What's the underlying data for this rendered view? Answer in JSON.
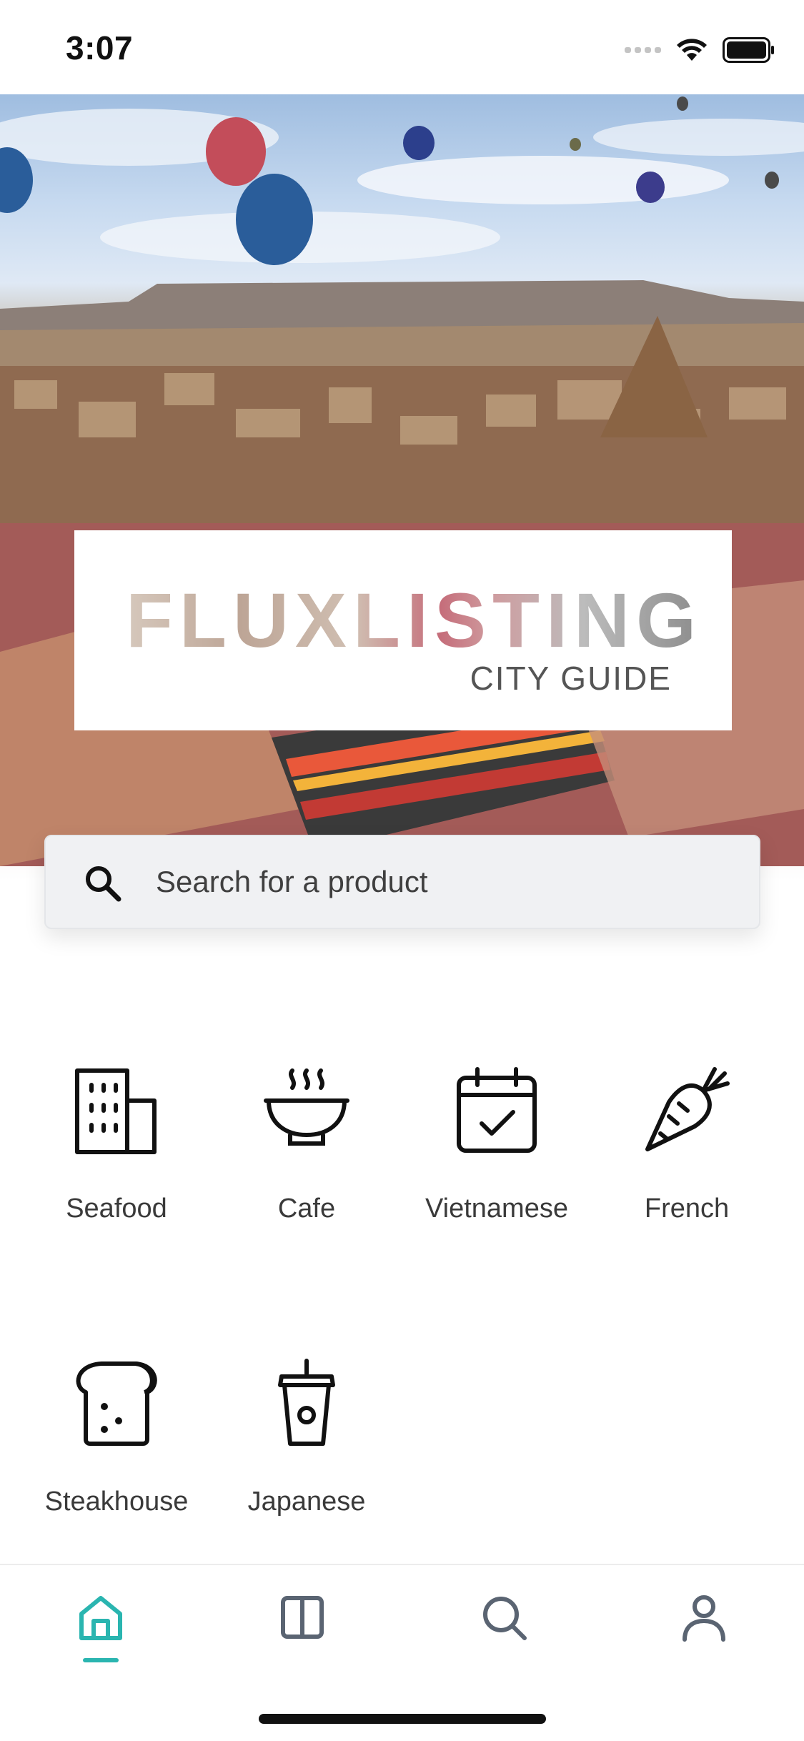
{
  "status_bar": {
    "time": "3:07"
  },
  "hero": {
    "logo_title": "FLUXLISTING",
    "logo_subtitle": "CITY GUIDE"
  },
  "search": {
    "placeholder": "Search for a product"
  },
  "categories": [
    {
      "label": "Seafood",
      "icon": "building-icon"
    },
    {
      "label": "Cafe",
      "icon": "hot-bowl-icon"
    },
    {
      "label": "Vietnamese",
      "icon": "calendar-check-icon"
    },
    {
      "label": "French",
      "icon": "carrot-icon"
    },
    {
      "label": "Steakhouse",
      "icon": "bread-icon"
    },
    {
      "label": "Japanese",
      "icon": "drink-cup-icon"
    }
  ],
  "tab_bar": {
    "items": [
      {
        "name": "home",
        "icon": "home-icon",
        "active": true
      },
      {
        "name": "listings",
        "icon": "columns-icon",
        "active": false
      },
      {
        "name": "search",
        "icon": "search-icon",
        "active": false
      },
      {
        "name": "profile",
        "icon": "user-icon",
        "active": false
      }
    ],
    "accent": "#2ab5b0",
    "icon_color": "#5a6472"
  }
}
